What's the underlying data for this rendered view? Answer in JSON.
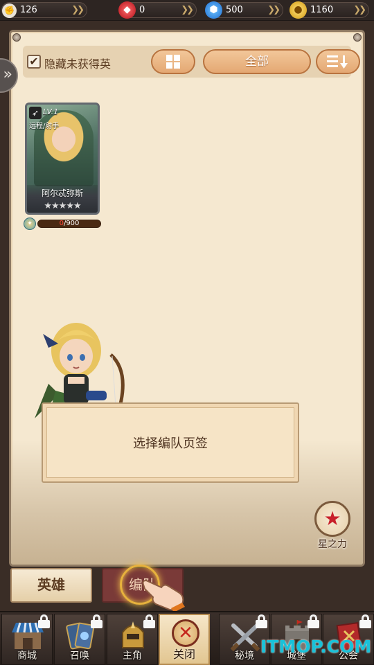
{
  "resources": {
    "energy": {
      "icon": "energy-icon",
      "value": "126"
    },
    "ruby": {
      "icon": "ruby-icon",
      "value": "0"
    },
    "diamond": {
      "icon": "diamond-icon",
      "value": "500"
    },
    "gold": {
      "icon": "gold-coin-icon",
      "value": "1160"
    }
  },
  "filter": {
    "hide_unowned_label": "隐藏未获得英",
    "hide_unowned_checked": true,
    "all_label": "全部"
  },
  "hero_card": {
    "level": "LV.1",
    "role": "远程/射手",
    "name": "阿尔忒弥斯",
    "stars": "★★★★★",
    "shards_current": "0",
    "shards_total": "/900"
  },
  "dialog": {
    "text": "选择编队页签"
  },
  "star_power": {
    "label": "星之力"
  },
  "tabs": {
    "hero": "英雄",
    "team": "编队"
  },
  "nav": [
    {
      "label": "商城",
      "locked": true
    },
    {
      "label": "召唤",
      "locked": true
    },
    {
      "label": "主角",
      "locked": true
    },
    {
      "label": "关闭",
      "locked": false
    },
    {
      "label": "秘境",
      "locked": true
    },
    {
      "label": "城堡",
      "locked": true
    },
    {
      "label": "公会",
      "locked": true
    }
  ],
  "watermark": "ITMOP.COM",
  "colors": {
    "accent": "#e4a873",
    "parchment": "#f5e8d0",
    "close_red": "#c4281e",
    "watermark": "#19c2d9"
  }
}
